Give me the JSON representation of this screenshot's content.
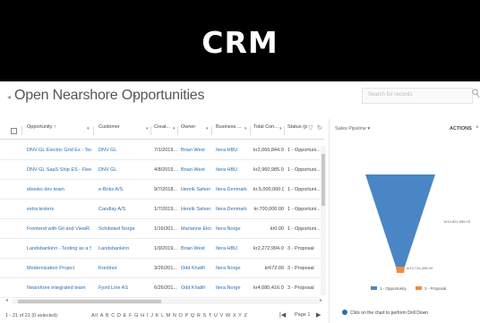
{
  "banner": {
    "title": "CRM"
  },
  "view": {
    "title": "Open Nearshore Opportunities",
    "search_placeholder": "Search for records"
  },
  "grid": {
    "columns": [
      {
        "label": "Opportunity ↑"
      },
      {
        "label": "Customer"
      },
      {
        "label": "Creat..."
      },
      {
        "label": "Owner"
      },
      {
        "label": "Business ..."
      },
      {
        "label": "Total Con..."
      },
      {
        "label": "Status (p"
      }
    ],
    "rows": [
      [
        "DNV GL Electric Grid Ex - Test A...",
        "DNV GL",
        "7/1/2019...",
        "Brian West",
        "Itera HBU",
        "kr2,066,844.00",
        "1 - Opportuni..."
      ],
      [
        "DNV GL SaaS Ship ES - Fleet co...",
        "DNV GL",
        "4/8/2019...",
        "Brian West",
        "Itera HBU",
        "kr2,960,985.00",
        "1 - Opportuni..."
      ],
      [
        "ebooks dev team",
        "e-Boks A/S",
        "9/7/2018...",
        "Henrik Sølver",
        "Itera Denmark",
        "kr.5,000,000.00",
        "1 - Opportuni..."
      ],
      [
        "extra testers",
        "Candlay A/S",
        "1/7/2019...",
        "Henrik Sølver",
        "Itera Denmark",
        "kr.700,000.00",
        "1 - Opportuni..."
      ],
      [
        "Frontend with Git and ViewR...",
        "Schibsted Norge",
        "1/16/201...",
        "Marianne Ekn...",
        "Itera Norge",
        "kr0.00",
        "1 - Opportuni..."
      ],
      [
        "Landsbankinn - Testing as a Se...",
        "Landsbankinn",
        "1/9/2019...",
        "Brian West",
        "Itera HBU",
        "kr2,272,994.00",
        "3 - Proposal"
      ],
      [
        "Modernization Project",
        "Kredinor",
        "3/26/201...",
        "Odd Khalifi",
        "Itera Norge",
        "kr672.00",
        "3 - Proposal"
      ],
      [
        "Nearshore integrated team",
        "Fjord Line AS",
        "6/26/201...",
        "Odd Khalifi",
        "Itera Norge",
        "kr4,080,416.00",
        "3 - Proposal"
      ]
    ],
    "record_count": "1 - 21 of 21 (0 selected)",
    "alphabet": "All  A  B  C  D  E  F  G  H  I  J  K  L  M  N  O  P  Q  R  S  T  U  V  W  X  Y  Z",
    "page_label": "Page 1"
  },
  "chart_panel": {
    "title": "Sales Pipeline",
    "actions_label": "ACTIONS",
    "note": "Click on the chart to perform Drill Down"
  },
  "chart_data": {
    "type": "funnel",
    "title": "Sales Pipeline",
    "stages": [
      {
        "name": "1 - Opportunity",
        "value_label": "kr14,821,656.03",
        "color": "#4a86c6"
      },
      {
        "name": "3 - Proposal",
        "value_label": "kr13,714,408.00",
        "color": "#f08c3a"
      }
    ],
    "legend": [
      "1 - Opportunity",
      "3 - Proposal"
    ],
    "legend_position": "bottom"
  }
}
